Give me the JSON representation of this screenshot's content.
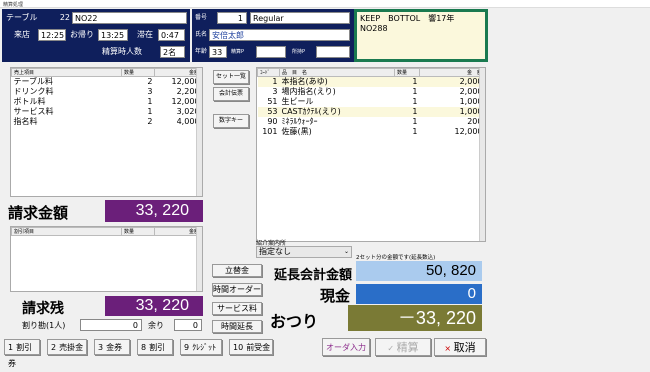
{
  "window_title": "精算処理",
  "top_left": {
    "table_label": "テーブル",
    "table_num": "22",
    "table_code": "NO22",
    "arrive_label": "来店",
    "arrive_time": "12:25",
    "leave_label": "お帰り",
    "leave_time": "13:25",
    "stay_label": "滞在",
    "stay_time": "0:47",
    "people_label": "精算時人数",
    "people_value": "2名"
  },
  "customer": {
    "num_label": "番号",
    "num_value": "1",
    "rank_value": "Regular",
    "name_label": "氏名",
    "name_value": "安倍太郎",
    "age_label": "年齢",
    "age_value": "33",
    "pointp_label": "精算P",
    "pointp_value": "",
    "owned_label": "所持P",
    "owned_value": ""
  },
  "keep": {
    "line1": "KEEP　BOTTOL　響17年",
    "line2": "NO288"
  },
  "left_table": {
    "headers": [
      "売上項目",
      "数量",
      "金額"
    ],
    "rows": [
      {
        "name": "テーブル料",
        "qty": "2",
        "amount": "12,000"
      },
      {
        "name": "ドリンク料",
        "qty": "3",
        "amount": "2,200"
      },
      {
        "name": "ボトル料",
        "qty": "1",
        "amount": "12,000"
      },
      {
        "name": "サービス料",
        "qty": "1",
        "amount": "3,020"
      },
      {
        "name": "指名料",
        "qty": "2",
        "amount": "4,000"
      }
    ]
  },
  "mid_buttons": {
    "set_list": "セット一覧",
    "accounting": "会計伝票",
    "numkey": "数字キー"
  },
  "right_table": {
    "headers": [
      "ｺｰﾄﾞ",
      "品　目　名",
      "数量",
      "金　額"
    ],
    "rows": [
      {
        "code": "1",
        "name": "本指名(あゆ)",
        "qty": "1",
        "amount": "2,000",
        "hl": true
      },
      {
        "code": "3",
        "name": "場内指名(えり)",
        "qty": "1",
        "amount": "2,000",
        "hl": false
      },
      {
        "code": "51",
        "name": "生ビール",
        "qty": "1",
        "amount": "1,000",
        "hl": false
      },
      {
        "code": "53",
        "name": "CASTｶｸﾃﾙ(えり)",
        "qty": "1",
        "amount": "1,000",
        "hl": true
      },
      {
        "code": "90",
        "name": "ﾐﾈﾗﾙｳｫｰﾀｰ",
        "qty": "1",
        "amount": "200",
        "hl": false
      },
      {
        "code": "101",
        "name": "佐藤(黒)",
        "qty": "1",
        "amount": "12,000",
        "hl": false
      }
    ]
  },
  "bill": {
    "label": "請求金額",
    "value": "33, 220"
  },
  "discount_table": {
    "headers": [
      "割引項目",
      "数量",
      "金額"
    ]
  },
  "referral": {
    "label": "紹介案内所",
    "selected": "指定なし"
  },
  "set_note": "2セット分の金額です(延長数込)",
  "extension": {
    "label": "延長会計金額",
    "value": "50, 820"
  },
  "cash": {
    "label": "現金",
    "value": "0"
  },
  "change": {
    "label": "おつり",
    "value": "－33, 220"
  },
  "remain": {
    "label": "請求残",
    "value": "33, 220"
  },
  "split": {
    "label": "割り勘(1人)",
    "value": "0",
    "rest_label": "余り",
    "rest_value": "0"
  },
  "actions": {
    "exchange": "立替金",
    "time_order": "時間オーダー",
    "service": "サービス料",
    "extend": "時間延長"
  },
  "footer": [
    {
      "num": "1",
      "label": "割引券"
    },
    {
      "num": "2",
      "label": "売掛金"
    },
    {
      "num": "3",
      "label": "金券"
    },
    {
      "num": "8",
      "label": "割引"
    },
    {
      "num": "9",
      "label": "ｸﾚｼﾞｯﾄ"
    },
    {
      "num": "10",
      "label": "前受金"
    }
  ],
  "order_input": "オーダ入力",
  "settle": "精算",
  "cancel": "取消",
  "colors": {
    "navy": "#0f1f5c",
    "purple": "#6b1f7a",
    "olive": "#7a7a35",
    "green": "#1a7a50",
    "blue": "#2a6ec8",
    "lightblue": "#aacbee"
  }
}
